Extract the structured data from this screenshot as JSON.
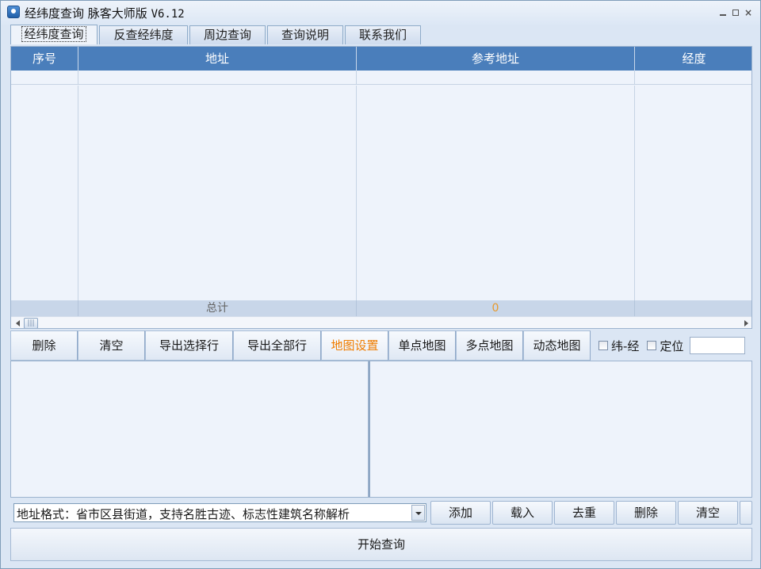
{
  "window": {
    "title": "经纬度查询 脉客大师版",
    "version": "V6.12"
  },
  "tabs": [
    {
      "label": "经纬度查询"
    },
    {
      "label": "反查经纬度"
    },
    {
      "label": "周边查询"
    },
    {
      "label": "查询说明"
    },
    {
      "label": "联系我们"
    }
  ],
  "grid": {
    "columns": [
      "序号",
      "地址",
      "参考地址",
      "经度"
    ],
    "total_label": "总计",
    "total_count": "0"
  },
  "toolbar": {
    "delete": "删除",
    "clear": "清空",
    "export_selected": "导出选择行",
    "export_all": "导出全部行",
    "map_settings": "地图设置",
    "single_map": "单点地图",
    "multi_map": "多点地图",
    "dynamic_map": "动态地图",
    "lat_lng_check": "纬-经",
    "locate_check": "定位",
    "input_value": ""
  },
  "address": {
    "format_hint": "地址格式：省市区县街道，支持名胜古迹、标志性建筑名称解析",
    "add": "添加",
    "load": "载入",
    "dedupe": "去重",
    "delete": "删除",
    "clear": "清空"
  },
  "start_button": "开始查询",
  "colors": {
    "header_blue": "#4a7ebb",
    "accent_orange": "#f07d00"
  }
}
